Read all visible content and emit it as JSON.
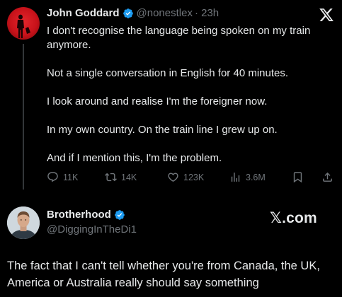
{
  "tweet1": {
    "author_name": "John Goddard",
    "author_handle": "@nonestlex",
    "time": "· 23h",
    "paragraphs": [
      "I don't recognise the language being spoken on my train anymore.",
      "Not a single conversation in English for 40 minutes.",
      "I look around and realise I'm the foreigner now.",
      "In my own country. On the train line I grew up on.",
      "And if I mention this, I'm the problem."
    ],
    "actions": {
      "replies": "11K",
      "reposts": "14K",
      "likes": "123K",
      "views": "3.6M"
    }
  },
  "tweet2": {
    "author_name": "Brotherhood",
    "author_handle": "@DiggingInTheDi1",
    "brand": "𝕏.com",
    "body": "The fact that I can't tell whether you're from Canada, the UK, America or Australia really should say something"
  },
  "icons": {
    "verified": "verified-badge-icon",
    "x_logo": "x-logo-icon",
    "reply": "reply-icon",
    "repost": "repost-icon",
    "like": "heart-icon",
    "views": "views-chart-icon",
    "bookmark": "bookmark-icon",
    "share": "share-icon"
  },
  "colors": {
    "background": "#000000",
    "text": "#e7e9ea",
    "muted": "#71767b",
    "verified": "#1d9bf0",
    "avatar1": "#c8121a"
  }
}
